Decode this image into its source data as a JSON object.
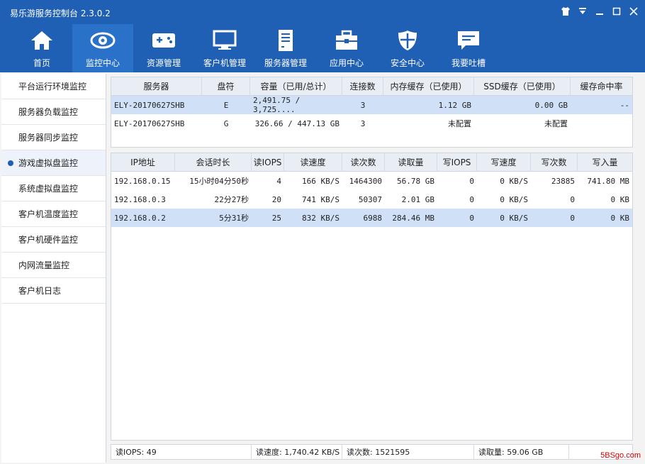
{
  "app": {
    "title": "易乐游服务控制台 2.3.0.2"
  },
  "window_controls": [
    "shirt-icon",
    "dropdown-icon",
    "minimize-icon",
    "maximize-icon",
    "close-icon"
  ],
  "nav": [
    {
      "label": "首页",
      "icon": "home-icon"
    },
    {
      "label": "监控中心",
      "icon": "eye-icon",
      "active": true
    },
    {
      "label": "资源管理",
      "icon": "gamepad-icon"
    },
    {
      "label": "客户机管理",
      "icon": "monitor-icon"
    },
    {
      "label": "服务器管理",
      "icon": "server-icon"
    },
    {
      "label": "应用中心",
      "icon": "toolbox-icon"
    },
    {
      "label": "安全中心",
      "icon": "shield-icon"
    },
    {
      "label": "我要吐槽",
      "icon": "chat-icon"
    }
  ],
  "sidebar": [
    {
      "label": "平台运行环境监控"
    },
    {
      "label": "服务器负载监控"
    },
    {
      "label": "服务器同步监控"
    },
    {
      "label": "游戏虚拟盘监控",
      "active": true
    },
    {
      "label": "系统虚拟盘监控"
    },
    {
      "label": "客户机温度监控"
    },
    {
      "label": "客户机硬件监控"
    },
    {
      "label": "内网流量监控"
    },
    {
      "label": "客户机日志"
    }
  ],
  "disk_table": {
    "headers": [
      "服务器",
      "盘符",
      "容量（已用/总计）",
      "连接数",
      "内存缓存（已使用）",
      "SSD缓存（已使用）",
      "缓存命中率"
    ],
    "rows": [
      [
        "ELY-20170627SHB",
        "E",
        "2,491.75 / 3,725....",
        "3",
        "1.12 GB",
        "0.00 GB",
        "--"
      ],
      [
        "ELY-20170627SHB",
        "G",
        "326.66 / 447.13 GB",
        "3",
        "未配置",
        "未配置",
        ""
      ]
    ]
  },
  "client_table": {
    "headers": [
      "IP地址",
      "会话时长",
      "读IOPS",
      "读速度",
      "读次数",
      "读取量",
      "写IOPS",
      "写速度",
      "写次数",
      "写入量"
    ],
    "rows": [
      [
        "192.168.0.15",
        "15小时04分50秒",
        "4",
        "166 KB/S",
        "1464300",
        "56.78 GB",
        "0",
        "0 KB/S",
        "23885",
        "741.80 MB"
      ],
      [
        "192.168.0.3",
        "22分27秒",
        "20",
        "741 KB/S",
        "50307",
        "2.01 GB",
        "0",
        "0 KB/S",
        "0",
        "0 KB"
      ],
      [
        "192.168.0.2",
        "5分31秒",
        "25",
        "832 KB/S",
        "6988",
        "284.46 MB",
        "0",
        "0 KB/S",
        "0",
        "0 KB"
      ]
    ]
  },
  "status": [
    "读IOPS: 49",
    "读速度: 1,740.42 KB/S",
    "读次数: 1521595",
    "",
    "读取量: 59.06 GB",
    ""
  ],
  "watermark": "5BSgo.com"
}
